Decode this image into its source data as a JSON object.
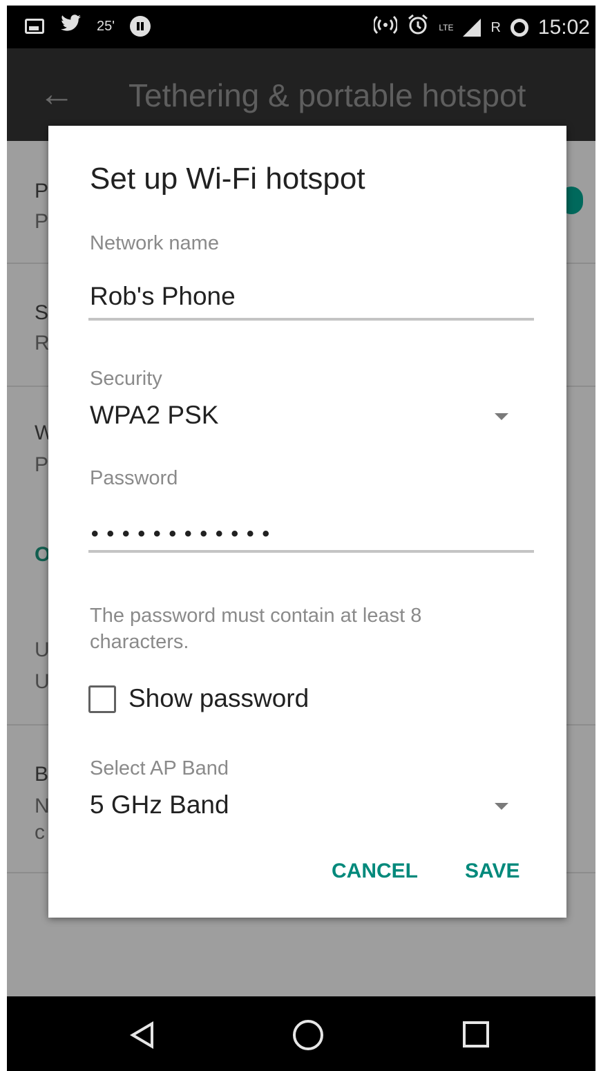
{
  "status_bar": {
    "temperature": "25'",
    "network_badge": "LTE",
    "roaming": "R",
    "time": "15:02",
    "icons": [
      "image-icon",
      "twitter-icon",
      "pause-circle-icon",
      "hotspot-icon",
      "alarm-icon",
      "signal-icon",
      "battery-ring-icon"
    ]
  },
  "app_bar": {
    "title": "Tethering & portable hotspot",
    "back_icon": "arrow-back-icon"
  },
  "background_list": {
    "row_initials": [
      {
        "title": "P",
        "subtitle": "P"
      },
      {
        "title": "S",
        "subtitle": "R"
      },
      {
        "title": "W",
        "subtitle": "P"
      },
      {
        "title": "O",
        "subtitle": ""
      },
      {
        "title": "U",
        "subtitle": "U"
      },
      {
        "title": "B",
        "subtitle": "N",
        "extra": "c"
      }
    ]
  },
  "dialog": {
    "title": "Set up Wi-Fi hotspot",
    "network_name": {
      "label": "Network name",
      "value": "Rob's Phone"
    },
    "security": {
      "label": "Security",
      "value": "WPA2 PSK"
    },
    "password": {
      "label": "Password",
      "masked_value": "••••••••••••"
    },
    "hint": "The password must contain at least 8 characters.",
    "show_password": {
      "label": "Show password",
      "checked": false
    },
    "ap_band": {
      "label": "Select AP Band",
      "value": "5 GHz Band"
    },
    "cancel_label": "CANCEL",
    "save_label": "SAVE"
  },
  "nav_bar": {
    "icons": [
      "nav-back-icon",
      "nav-home-icon",
      "nav-recents-icon"
    ]
  },
  "colors": {
    "accent": "#00897b",
    "scrim": "#9e9e9e",
    "status_bar": "#000000",
    "app_bar": "#212121"
  }
}
